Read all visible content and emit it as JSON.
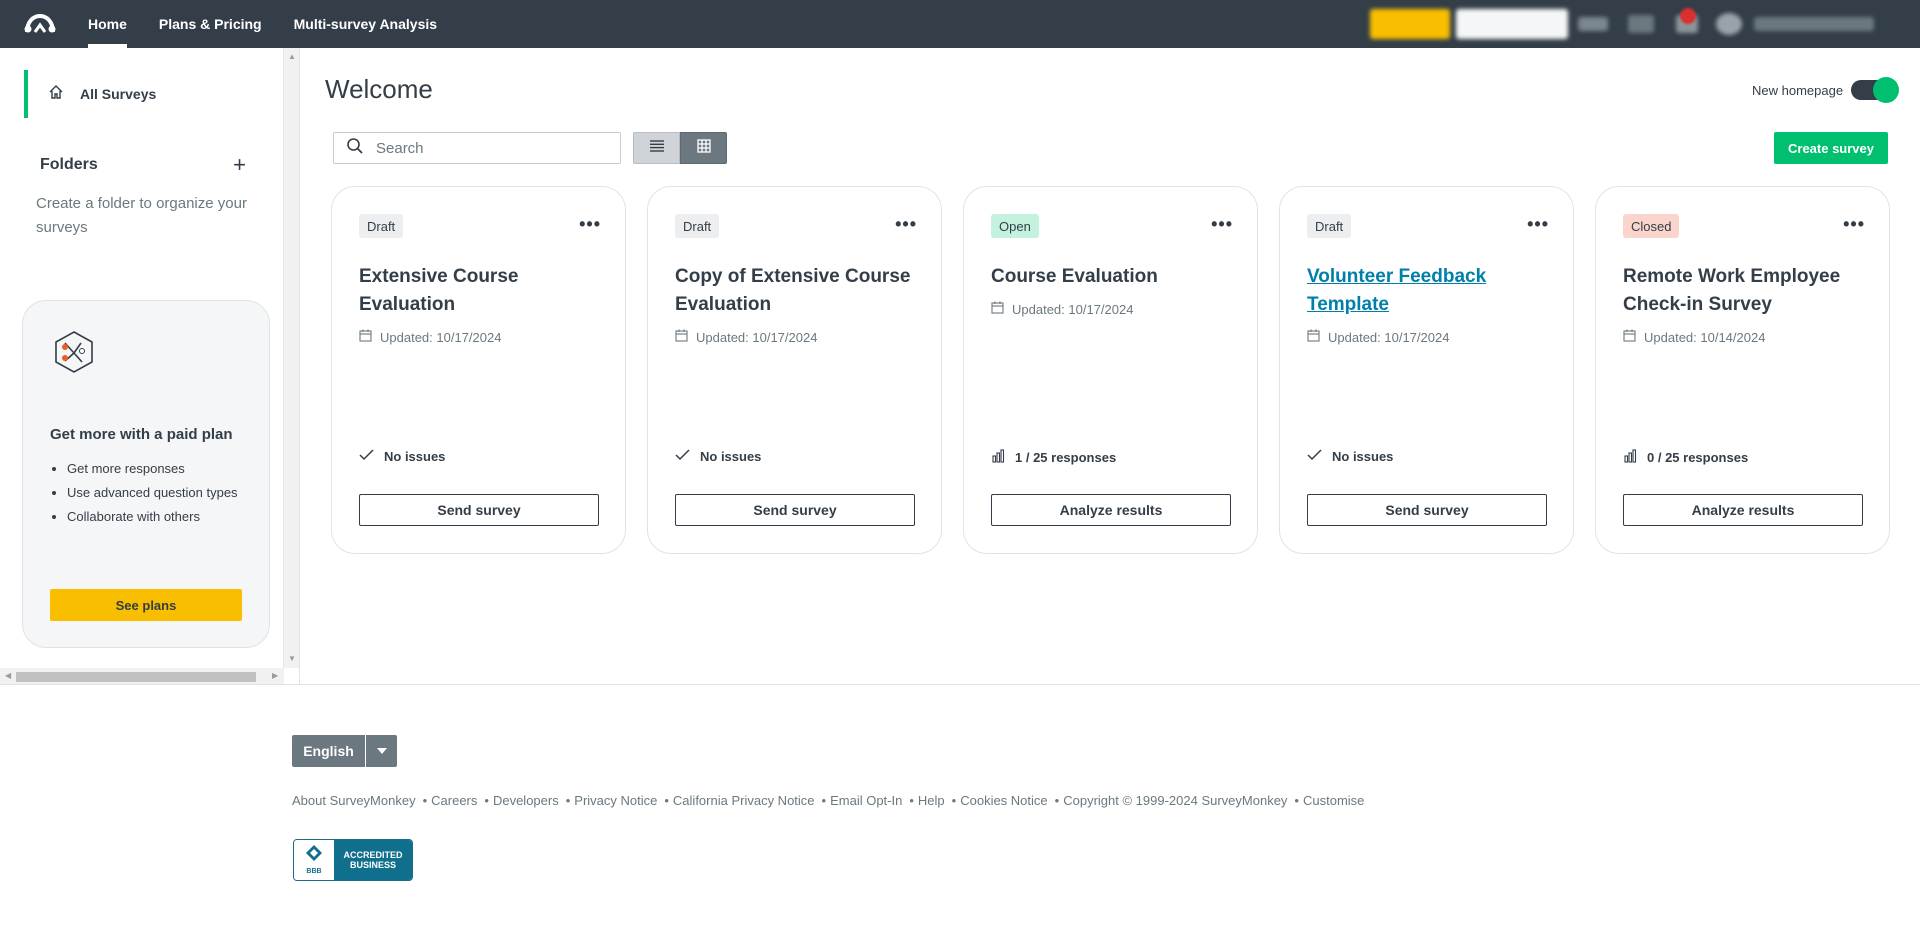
{
  "topbar": {
    "nav": [
      {
        "label": "Home"
      },
      {
        "label": "Plans & Pricing"
      },
      {
        "label": "Multi-survey Analysis"
      }
    ]
  },
  "sidebar": {
    "all_surveys_label": "All Surveys",
    "folders_title": "Folders",
    "folder_hint": "Create a folder to organize your surveys",
    "promo": {
      "title": "Get more with a paid plan",
      "items": [
        "Get more responses",
        "Use advanced question types",
        "Collaborate with others"
      ],
      "button_label": "See plans"
    }
  },
  "main": {
    "title": "Welcome",
    "toggle_label": "New homepage",
    "search_placeholder": "Search",
    "create_label": "Create survey",
    "cards": [
      {
        "status": "Draft",
        "title": "Extensive Course Evaluation",
        "updated": "Updated: 10/17/2024",
        "info": "No issues",
        "info_icon": "check-icon",
        "button": "Send survey"
      },
      {
        "status": "Draft",
        "title": "Copy of Extensive Course Evaluation",
        "updated": "Updated: 10/17/2024",
        "info": "No issues",
        "info_icon": "check-icon",
        "button": "Send survey"
      },
      {
        "status": "Open",
        "title": "Course Evaluation",
        "updated": "Updated: 10/17/2024",
        "info": "1 / 25 responses",
        "info_icon": "bar-chart-icon",
        "button": "Analyze results"
      },
      {
        "status": "Draft",
        "title": "Volunteer Feedback Template",
        "updated": "Updated: 10/17/2024",
        "info": "No issues",
        "info_icon": "check-icon",
        "button": "Send survey"
      },
      {
        "status": "Closed",
        "title": "Remote Work Employee Check-in Survey",
        "updated": "Updated: 10/14/2024",
        "info": "0 / 25 responses",
        "info_icon": "bar-chart-icon",
        "button": "Analyze results"
      }
    ]
  },
  "footer": {
    "language": "English",
    "links": [
      "About SurveyMonkey",
      "Careers",
      "Developers",
      "Privacy Notice",
      "California Privacy Notice",
      "Email Opt-In",
      "Help",
      "Cookies Notice",
      "Copyright © 1999-2024 SurveyMonkey",
      "Customise"
    ],
    "bbb": {
      "mark": "BBB",
      "line1": "ACCREDITED",
      "line2": "BUSINESS"
    }
  },
  "colors": {
    "topbar": "#333e48",
    "accent_green": "#00bf6f",
    "promo_yellow": "#f9be00",
    "link_blue": "#007faa"
  }
}
